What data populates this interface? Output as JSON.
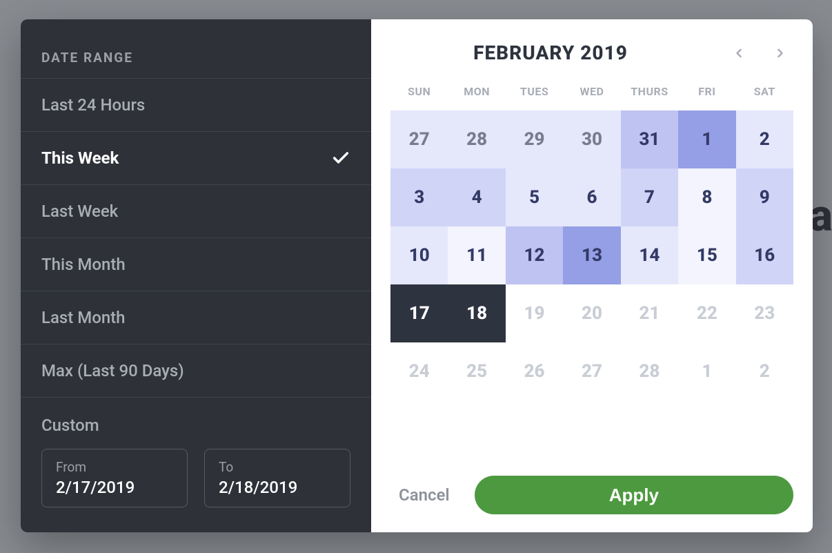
{
  "sidebar": {
    "header": "DATE RANGE",
    "items": [
      {
        "label": "Last 24 Hours",
        "selected": false
      },
      {
        "label": "This Week",
        "selected": true
      },
      {
        "label": "Last Week",
        "selected": false
      },
      {
        "label": "This Month",
        "selected": false
      },
      {
        "label": "Last Month",
        "selected": false
      },
      {
        "label": "Max (Last 90 Days)",
        "selected": false
      }
    ],
    "custom_label": "Custom",
    "from_label": "From",
    "to_label": "To",
    "from_value": "2/17/2019",
    "to_value": "2/18/2019"
  },
  "calendar": {
    "title": "FEBRUARY 2019",
    "dow": [
      "SUN",
      "MON",
      "TUES",
      "WED",
      "THURS",
      "FRI",
      "SAT"
    ],
    "rows": [
      [
        {
          "n": "27",
          "cls": "s1"
        },
        {
          "n": "28",
          "cls": "s1"
        },
        {
          "n": "29",
          "cls": "s1"
        },
        {
          "n": "30",
          "cls": "s1"
        },
        {
          "n": "31",
          "cls": "s5"
        },
        {
          "n": "1",
          "cls": "s6"
        },
        {
          "n": "2",
          "cls": "s3"
        }
      ],
      [
        {
          "n": "3",
          "cls": "s2"
        },
        {
          "n": "4",
          "cls": "s2"
        },
        {
          "n": "5",
          "cls": "s3"
        },
        {
          "n": "6",
          "cls": "s3"
        },
        {
          "n": "7",
          "cls": "s2"
        },
        {
          "n": "8",
          "cls": "s7"
        },
        {
          "n": "9",
          "cls": "s2"
        }
      ],
      [
        {
          "n": "10",
          "cls": "s3"
        },
        {
          "n": "11",
          "cls": "s7"
        },
        {
          "n": "12",
          "cls": "s5"
        },
        {
          "n": "13",
          "cls": "s6"
        },
        {
          "n": "14",
          "cls": "s3"
        },
        {
          "n": "15",
          "cls": "s7"
        },
        {
          "n": "16",
          "cls": "s2"
        }
      ],
      [
        {
          "n": "17",
          "cls": "sel"
        },
        {
          "n": "18",
          "cls": "sel"
        },
        {
          "n": "19",
          "cls": "future"
        },
        {
          "n": "20",
          "cls": "future"
        },
        {
          "n": "21",
          "cls": "future"
        },
        {
          "n": "22",
          "cls": "future"
        },
        {
          "n": "23",
          "cls": "future"
        }
      ],
      [
        {
          "n": "24",
          "cls": "future"
        },
        {
          "n": "25",
          "cls": "future"
        },
        {
          "n": "26",
          "cls": "future"
        },
        {
          "n": "27",
          "cls": "future"
        },
        {
          "n": "28",
          "cls": "future"
        },
        {
          "n": "1",
          "cls": "future"
        },
        {
          "n": "2",
          "cls": "future"
        }
      ]
    ]
  },
  "actions": {
    "cancel": "Cancel",
    "apply": "Apply"
  },
  "background_hint": "ba"
}
